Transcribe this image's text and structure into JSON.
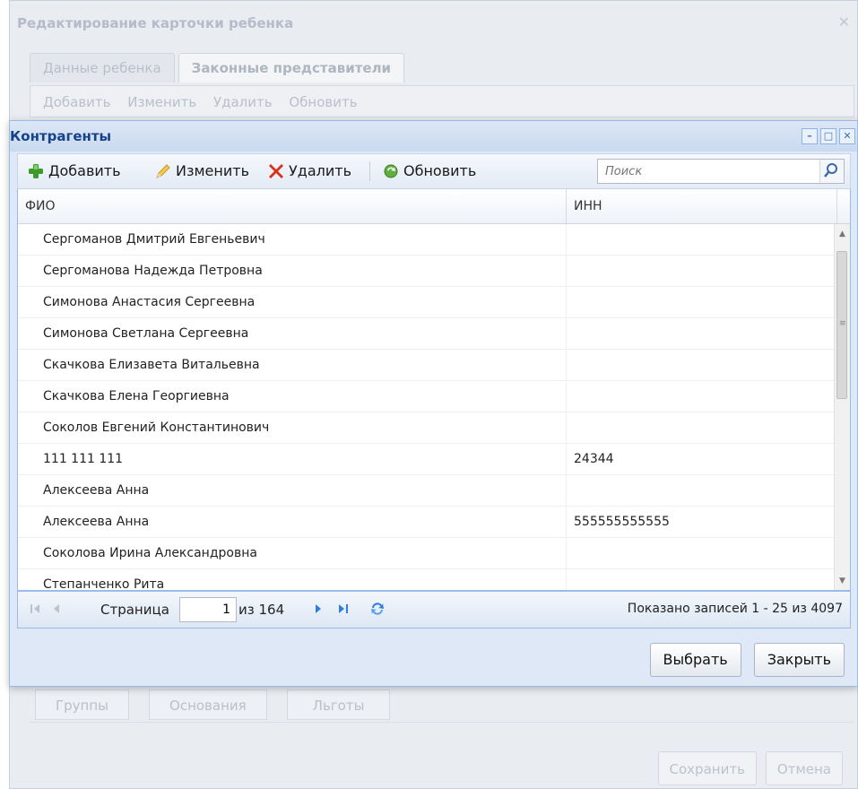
{
  "background_window": {
    "title": "Редактирование карточки ребенка",
    "close": "✕",
    "tabs": [
      "Данные ребенка",
      "Законные представители"
    ],
    "toolbar": [
      "Добавить",
      "Изменить",
      "Удалить",
      "Обновить"
    ],
    "bottom_tabs": [
      "Группы",
      "Основания",
      "Льготы"
    ],
    "save_label": "Сохранить",
    "cancel_label": "Отмена"
  },
  "modal": {
    "title": "Контрагенты",
    "toolbar": {
      "add_label": "Добавить",
      "edit_label": "Изменить",
      "delete_label": "Удалить",
      "refresh_label": "Обновить"
    },
    "search": {
      "placeholder": "Поиск",
      "icon": "magnifier-icon"
    },
    "grid": {
      "columns": [
        "ФИО",
        "ИНН"
      ],
      "rows": [
        {
          "fio": "Сергоманов Дмитрий Евгеньевич",
          "inn": ""
        },
        {
          "fio": "Сергоманова Надежда Петровна",
          "inn": ""
        },
        {
          "fio": "Симонова Анастасия Сергеевна",
          "inn": ""
        },
        {
          "fio": "Симонова Светлана Сергеевна",
          "inn": ""
        },
        {
          "fio": "Скачкова Елизавета Витальевна",
          "inn": ""
        },
        {
          "fio": "Скачкова Елена Георгиевна",
          "inn": ""
        },
        {
          "fio": "Соколов Евгений Константинович",
          "inn": ""
        },
        {
          "fio": "111 111 111",
          "inn": "24344"
        },
        {
          "fio": "Алексеева Анна",
          "inn": ""
        },
        {
          "fio": "Алексеева Анна",
          "inn": "555555555555"
        },
        {
          "fio": "Соколова Ирина Александровна",
          "inn": ""
        },
        {
          "fio": "Степанченко Рита",
          "inn": ""
        }
      ]
    },
    "paging": {
      "page_label": "Страница",
      "page_value": "1",
      "of_label": "из 164",
      "info": "Показано записей 1 - 25 из 4097"
    },
    "select_label": "Выбрать",
    "close_label": "Закрыть"
  },
  "colors": {
    "header_text": "#15428b",
    "border_blue": "#99bbe8",
    "add_green": "#3a9a2a",
    "delete_red": "#d9321b",
    "nav_blue": "#2f7ed8"
  }
}
